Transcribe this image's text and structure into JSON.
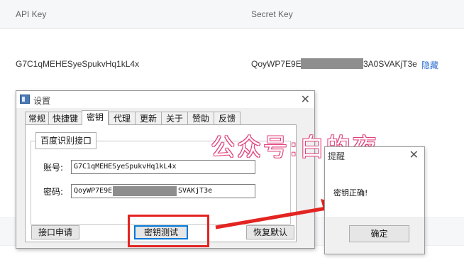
{
  "table": {
    "col_api_key": "API Key",
    "col_secret_key": "Secret Key",
    "api_key_value": "G7C1qMEHESyeSpukvHq1kL4x",
    "secret_key_prefix": "QoyWP7E9E",
    "secret_key_suffix": "3A0SVAKjT3e",
    "hide_link": "隐藏"
  },
  "settings_window": {
    "title": "设置",
    "tabs": [
      "常规",
      "快捷键",
      "密钥",
      "代理",
      "更新",
      "关于",
      "赞助",
      "反馈"
    ],
    "active_tab": "密钥",
    "group_title": "百度识别接口",
    "account_label": "账号:",
    "account_value": "G7C1qMEHESyeSpukvHq1kL4x",
    "password_label": "密码:",
    "password_prefix": "QoyWP7E9E",
    "password_suffix": "SVAKjT3e",
    "apply_button": "接口申请",
    "test_button": "密钥测试",
    "reset_button": "恢复默认"
  },
  "watermark": "公众号:白的夜",
  "message_box": {
    "title": "提醒",
    "text": "密钥正确!",
    "ok_button": "确定"
  },
  "colors": {
    "highlight_red": "#e32421",
    "link_blue": "#2f6fd0",
    "watermark_pink": "#e0417a"
  }
}
